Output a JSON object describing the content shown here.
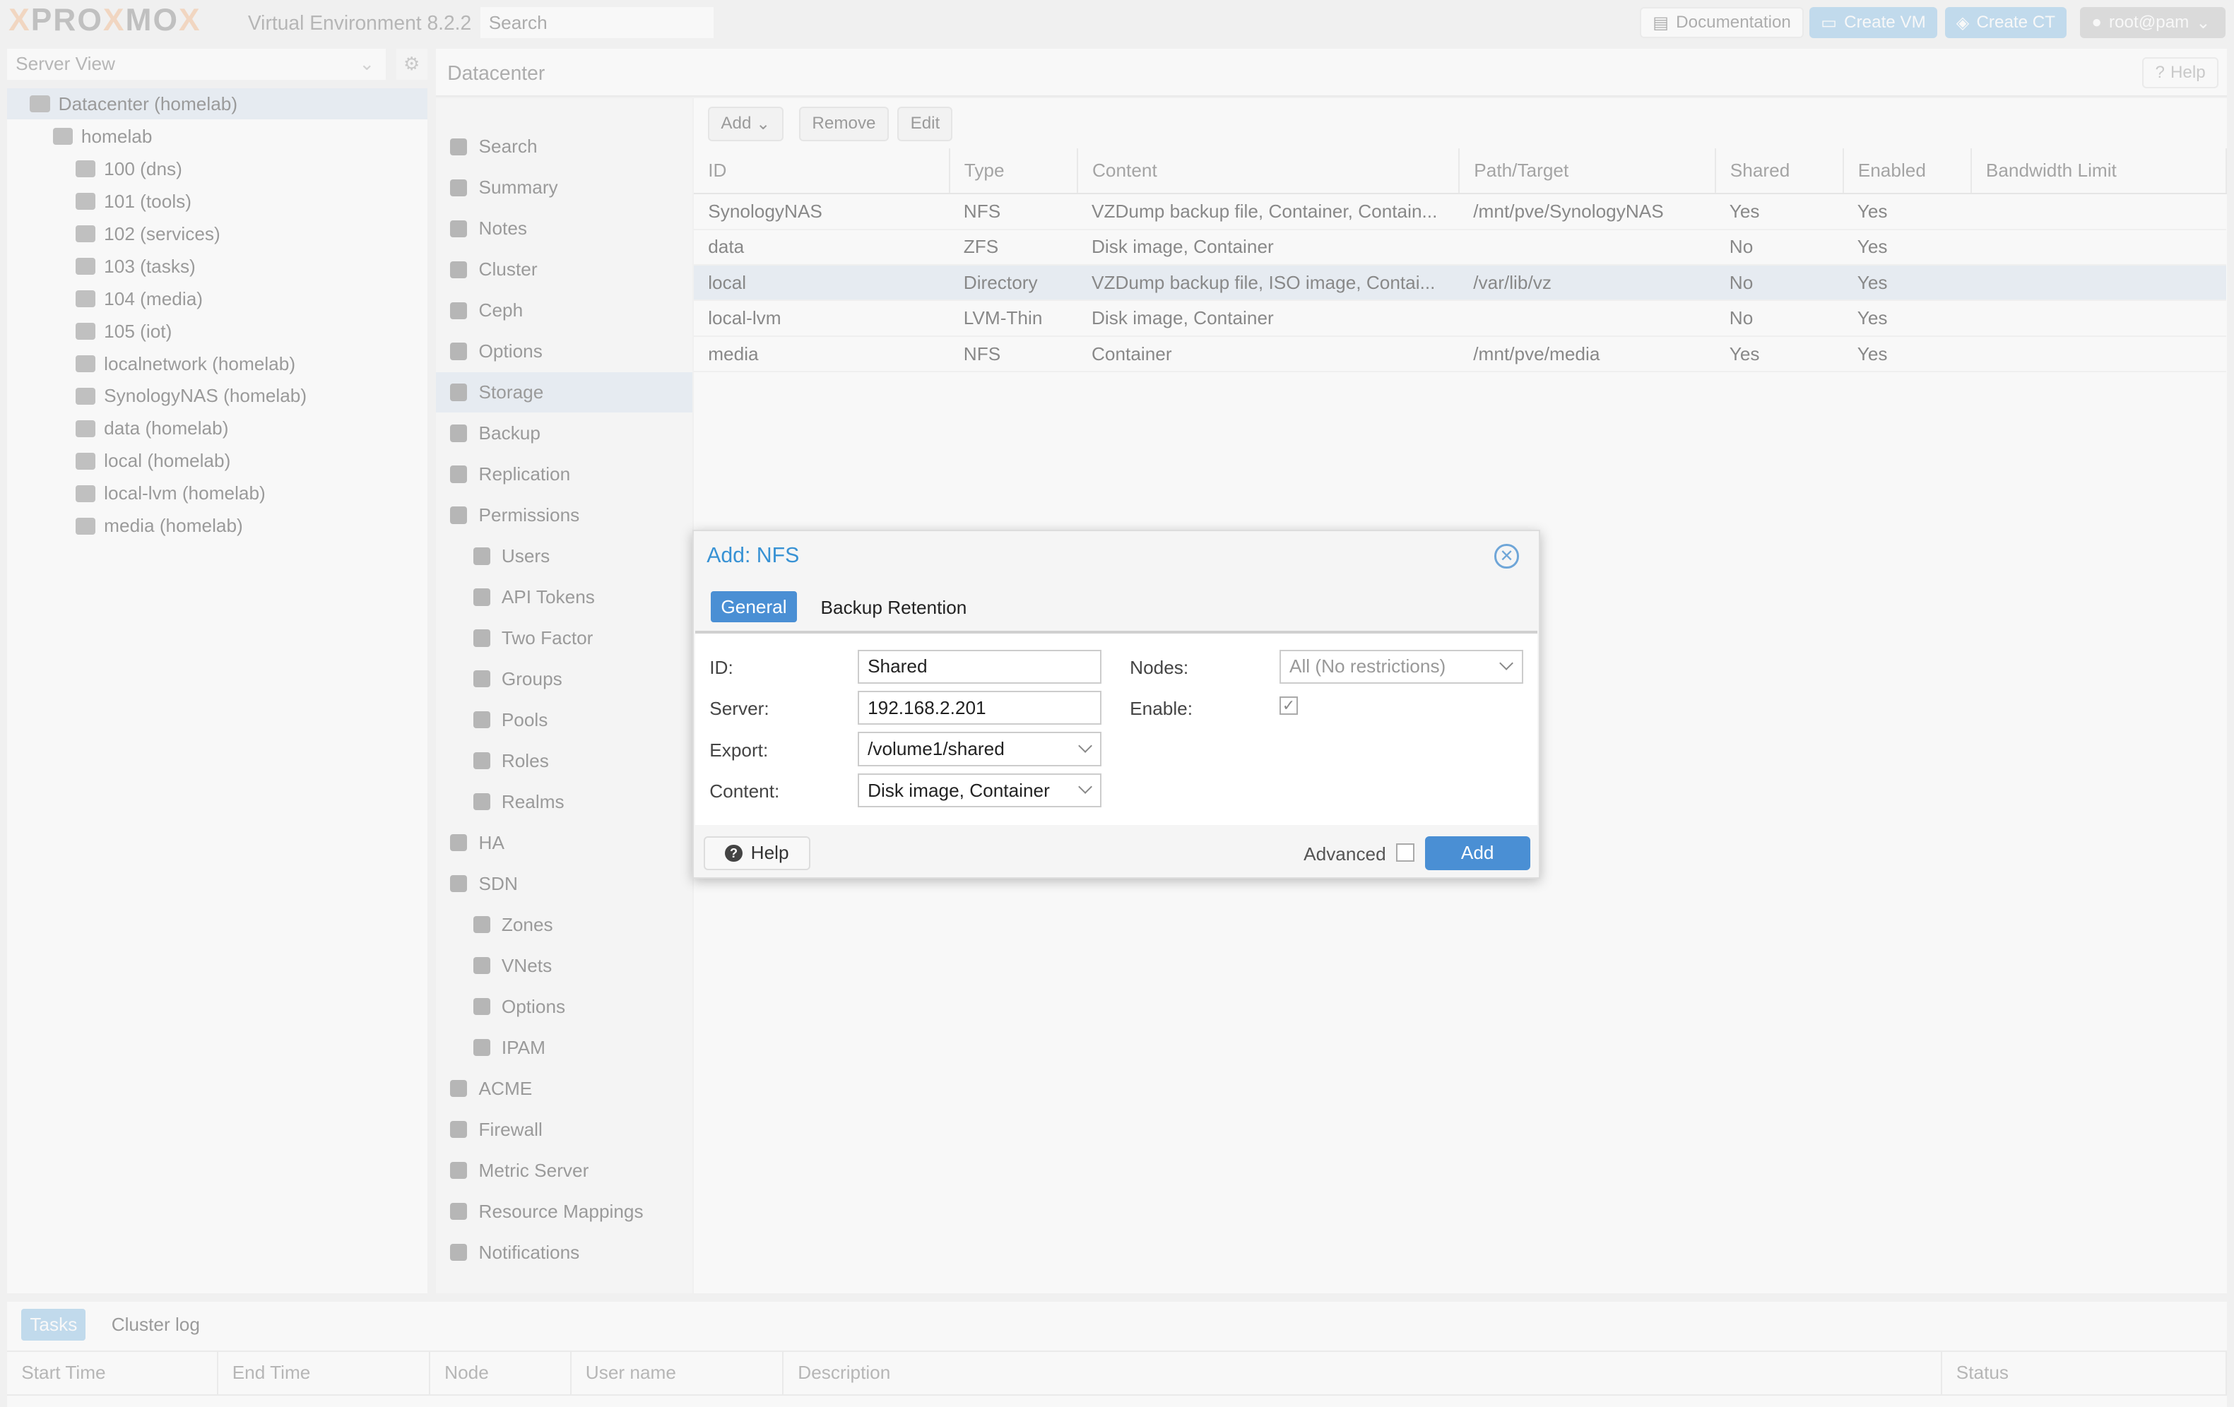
{
  "header": {
    "brand": "PROXMOX",
    "product": "Virtual Environment 8.2.2",
    "search_placeholder": "Search",
    "documentation": "Documentation",
    "create_vm": "Create VM",
    "create_ct": "Create CT",
    "user": "root@pam"
  },
  "sidebar": {
    "view": "Server View",
    "tree": [
      {
        "label": "Datacenter (homelab)",
        "icon": "datacenter-icon",
        "level": 0
      },
      {
        "label": "homelab",
        "icon": "node-icon",
        "level": 1
      },
      {
        "label": "100 (dns)",
        "icon": "container-icon",
        "level": 2
      },
      {
        "label": "101 (tools)",
        "icon": "container-icon",
        "level": 2
      },
      {
        "label": "102 (services)",
        "icon": "container-icon",
        "level": 2
      },
      {
        "label": "103 (tasks)",
        "icon": "container-icon",
        "level": 2
      },
      {
        "label": "104 (media)",
        "icon": "container-icon",
        "level": 2
      },
      {
        "label": "105 (iot)",
        "icon": "container-icon",
        "level": 2
      },
      {
        "label": "localnetwork (homelab)",
        "icon": "network-icon",
        "level": 2
      },
      {
        "label": "SynologyNAS (homelab)",
        "icon": "storage-icon",
        "level": 2
      },
      {
        "label": "data (homelab)",
        "icon": "storage-icon",
        "level": 2
      },
      {
        "label": "local (homelab)",
        "icon": "storage-icon",
        "level": 2
      },
      {
        "label": "local-lvm (homelab)",
        "icon": "storage-icon",
        "level": 2
      },
      {
        "label": "media (homelab)",
        "icon": "storage-icon",
        "level": 2
      }
    ]
  },
  "content": {
    "title": "Datacenter",
    "help": "Help"
  },
  "menu": [
    {
      "label": "Search",
      "sub": false
    },
    {
      "label": "Summary",
      "sub": false
    },
    {
      "label": "Notes",
      "sub": false
    },
    {
      "label": "Cluster",
      "sub": false
    },
    {
      "label": "Ceph",
      "sub": false
    },
    {
      "label": "Options",
      "sub": false
    },
    {
      "label": "Storage",
      "sub": false,
      "selected": true
    },
    {
      "label": "Backup",
      "sub": false
    },
    {
      "label": "Replication",
      "sub": false
    },
    {
      "label": "Permissions",
      "sub": false
    },
    {
      "label": "Users",
      "sub": true
    },
    {
      "label": "API Tokens",
      "sub": true
    },
    {
      "label": "Two Factor",
      "sub": true
    },
    {
      "label": "Groups",
      "sub": true
    },
    {
      "label": "Pools",
      "sub": true
    },
    {
      "label": "Roles",
      "sub": true
    },
    {
      "label": "Realms",
      "sub": true
    },
    {
      "label": "HA",
      "sub": false
    },
    {
      "label": "SDN",
      "sub": false
    },
    {
      "label": "Zones",
      "sub": true
    },
    {
      "label": "VNets",
      "sub": true
    },
    {
      "label": "Options",
      "sub": true
    },
    {
      "label": "IPAM",
      "sub": true
    },
    {
      "label": "ACME",
      "sub": false
    },
    {
      "label": "Firewall",
      "sub": false
    },
    {
      "label": "Metric Server",
      "sub": false
    },
    {
      "label": "Resource Mappings",
      "sub": false
    },
    {
      "label": "Notifications",
      "sub": false
    }
  ],
  "toolbar": {
    "add": "Add",
    "remove": "Remove",
    "edit": "Edit"
  },
  "storage_table": {
    "columns": [
      "ID",
      "Type",
      "Content",
      "Path/Target",
      "Shared",
      "Enabled",
      "Bandwidth Limit"
    ],
    "rows": [
      [
        "SynologyNAS",
        "NFS",
        "VZDump backup file, Container, Contain...",
        "/mnt/pve/SynologyNAS",
        "Yes",
        "Yes",
        ""
      ],
      [
        "data",
        "ZFS",
        "Disk image, Container",
        "",
        "No",
        "Yes",
        ""
      ],
      [
        "local",
        "Directory",
        "VZDump backup file, ISO image, Contai...",
        "/var/lib/vz",
        "No",
        "Yes",
        ""
      ],
      [
        "local-lvm",
        "LVM-Thin",
        "Disk image, Container",
        "",
        "No",
        "Yes",
        ""
      ],
      [
        "media",
        "NFS",
        "Container",
        "/mnt/pve/media",
        "Yes",
        "Yes",
        ""
      ]
    ],
    "selected_row": 2
  },
  "dialog": {
    "title": "Add: NFS",
    "tabs": [
      "General",
      "Backup Retention"
    ],
    "active_tab": "General",
    "id_label": "ID:",
    "id_value": "Shared",
    "server_label": "Server:",
    "server_value": "192.168.2.201",
    "export_label": "Export:",
    "export_value": "/volume1/shared",
    "content_label": "Content:",
    "content_value": "Disk image, Container",
    "nodes_label": "Nodes:",
    "nodes_value": "All (No restrictions)",
    "enable_label": "Enable:",
    "enable_checked": true,
    "help": "Help",
    "advanced": "Advanced",
    "advanced_checked": false,
    "add": "Add"
  },
  "bottom": {
    "tabs": [
      "Tasks",
      "Cluster log"
    ],
    "columns": [
      "Start Time",
      "End Time",
      "Node",
      "User name",
      "Description",
      "Status"
    ]
  },
  "colors": {
    "accent": "#3892d4",
    "selected": "#dfe8f2",
    "brand_orange": "#e57000"
  }
}
